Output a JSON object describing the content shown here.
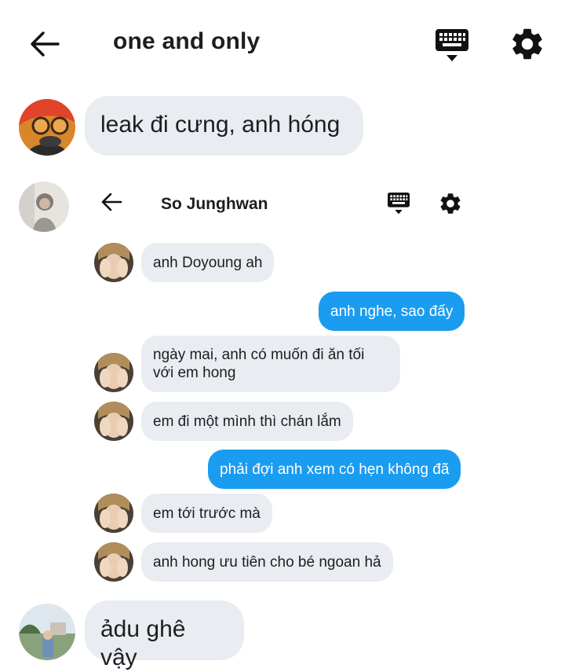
{
  "header": {
    "title": "one and only",
    "icons": {
      "back": "arrow-left-icon",
      "keyboard": "keyboard-icon",
      "settings": "gear-icon"
    }
  },
  "messages": [
    {
      "side": "left",
      "avatar": "avatar-orange-hair",
      "text": "leak đi cưng, anh hóng"
    },
    {
      "side": "left",
      "avatar": "avatar-grey-hoodie",
      "type": "screenshot"
    },
    {
      "side": "left",
      "avatar": "avatar-outdoor",
      "text": "ảdu ghê vậy"
    }
  ],
  "embedded_chat": {
    "title": "So Junghwan",
    "icons": {
      "back": "arrow-left-icon",
      "keyboard": "keyboard-icon",
      "settings": "gear-icon"
    },
    "messages": [
      {
        "side": "left",
        "lines": [
          "anh Doyoung ah"
        ]
      },
      {
        "side": "right",
        "lines": [
          "anh nghe, sao đấy"
        ]
      },
      {
        "side": "left",
        "lines": [
          "ngày mai, anh có muốn đi ăn tối",
          "với em hong"
        ]
      },
      {
        "side": "left",
        "lines": [
          "em đi một mình thì chán lắm"
        ]
      },
      {
        "side": "right",
        "lines": [
          "phải đợi anh xem có hẹn không đã"
        ]
      },
      {
        "side": "left",
        "lines": [
          "em tới trước mà"
        ]
      },
      {
        "side": "left",
        "lines": [
          "anh hong ưu tiên cho bé ngoan hả"
        ]
      }
    ]
  },
  "colors": {
    "incoming_bubble": "#e9edf1",
    "outgoing_bubble": "#1a9cf0",
    "background": "#ffffff"
  }
}
